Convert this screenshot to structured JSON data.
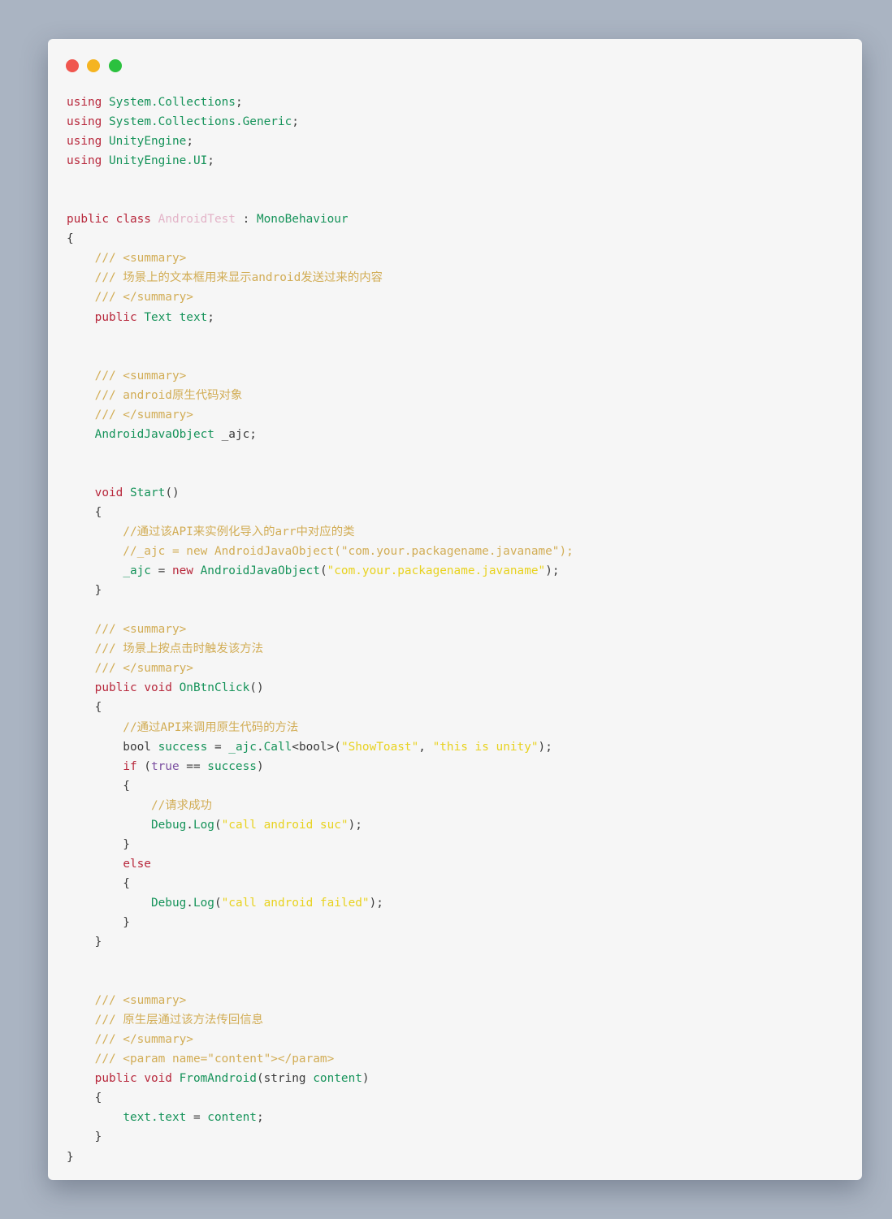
{
  "window": {
    "controls": [
      {
        "name": "close-button",
        "color": "#f0564f"
      },
      {
        "name": "minimize-button",
        "color": "#f5b421"
      },
      {
        "name": "maximize-button",
        "color": "#2bc13e"
      }
    ]
  },
  "colors": {
    "keyword": "#b8283c",
    "identifier": "#16935a",
    "comment": "#d2ad56",
    "string": "#e8d21f",
    "plain": "#3a3a3a",
    "class_name": "#e3b4c8",
    "boolean": "#7b4fa0",
    "background": "#aab4c2",
    "card": "#f6f6f6"
  },
  "code": {
    "lines": [
      [
        [
          "k",
          "using"
        ],
        [
          "p",
          " "
        ],
        [
          "t",
          "System.Collections"
        ],
        [
          "p",
          ";"
        ]
      ],
      [
        [
          "k",
          "using"
        ],
        [
          "p",
          " "
        ],
        [
          "t",
          "System.Collections.Generic"
        ],
        [
          "p",
          ";"
        ]
      ],
      [
        [
          "k",
          "using"
        ],
        [
          "p",
          " "
        ],
        [
          "t",
          "UnityEngine"
        ],
        [
          "p",
          ";"
        ]
      ],
      [
        [
          "k",
          "using"
        ],
        [
          "p",
          " "
        ],
        [
          "t",
          "UnityEngine.UI"
        ],
        [
          "p",
          ";"
        ]
      ],
      [],
      [],
      [
        [
          "k",
          "public"
        ],
        [
          "p",
          " "
        ],
        [
          "k",
          "class"
        ],
        [
          "p",
          " "
        ],
        [
          "n",
          "AndroidTest"
        ],
        [
          "p",
          " : "
        ],
        [
          "t",
          "MonoBehaviour"
        ]
      ],
      [
        [
          "p",
          "{"
        ]
      ],
      [
        [
          "c",
          "    /// <summary>"
        ]
      ],
      [
        [
          "c",
          "    /// 场景上的文本框用来显示android发送过来的内容"
        ]
      ],
      [
        [
          "c",
          "    /// </summary>"
        ]
      ],
      [
        [
          "p",
          "    "
        ],
        [
          "k",
          "public"
        ],
        [
          "p",
          " "
        ],
        [
          "t",
          "Text"
        ],
        [
          "p",
          " "
        ],
        [
          "t",
          "text"
        ],
        [
          "p",
          ";"
        ]
      ],
      [],
      [],
      [
        [
          "c",
          "    /// <summary>"
        ]
      ],
      [
        [
          "c",
          "    /// android原生代码对象"
        ]
      ],
      [
        [
          "c",
          "    /// </summary>"
        ]
      ],
      [
        [
          "p",
          "    "
        ],
        [
          "t",
          "AndroidJavaObject"
        ],
        [
          "p",
          " _ajc;"
        ]
      ],
      [],
      [],
      [
        [
          "p",
          "    "
        ],
        [
          "k",
          "void"
        ],
        [
          "p",
          " "
        ],
        [
          "t",
          "Start"
        ],
        [
          "p",
          "()"
        ]
      ],
      [
        [
          "p",
          "    {"
        ]
      ],
      [
        [
          "c",
          "        //通过该API来实例化导入的arr中对应的类"
        ]
      ],
      [
        [
          "c",
          "        //_ajc = new AndroidJavaObject(\"com.your.packagename.javaname\");"
        ]
      ],
      [
        [
          "p",
          "        "
        ],
        [
          "t",
          "_ajc"
        ],
        [
          "p",
          " = "
        ],
        [
          "k",
          "new"
        ],
        [
          "p",
          " "
        ],
        [
          "t",
          "AndroidJavaObject"
        ],
        [
          "p",
          "("
        ],
        [
          "s",
          "\"com.your.packagename.javaname\""
        ],
        [
          "p",
          ");"
        ]
      ],
      [
        [
          "p",
          "    }"
        ]
      ],
      [],
      [
        [
          "c",
          "    /// <summary>"
        ]
      ],
      [
        [
          "c",
          "    /// 场景上按点击时触发该方法"
        ]
      ],
      [
        [
          "c",
          "    /// </summary>"
        ]
      ],
      [
        [
          "p",
          "    "
        ],
        [
          "k",
          "public"
        ],
        [
          "p",
          " "
        ],
        [
          "k",
          "void"
        ],
        [
          "p",
          " "
        ],
        [
          "t",
          "OnBtnClick"
        ],
        [
          "p",
          "()"
        ]
      ],
      [
        [
          "p",
          "    {"
        ]
      ],
      [
        [
          "c",
          "        //通过API来调用原生代码的方法"
        ]
      ],
      [
        [
          "p",
          "        bool "
        ],
        [
          "t",
          "success"
        ],
        [
          "p",
          " = "
        ],
        [
          "t",
          "_ajc"
        ],
        [
          "p",
          "."
        ],
        [
          "t",
          "Call"
        ],
        [
          "p",
          "<bool>("
        ],
        [
          "s",
          "\"ShowToast\""
        ],
        [
          "p",
          ", "
        ],
        [
          "s",
          "\"this is unity\""
        ],
        [
          "p",
          ");"
        ]
      ],
      [
        [
          "p",
          "        "
        ],
        [
          "k",
          "if"
        ],
        [
          "p",
          " ("
        ],
        [
          "b",
          "true"
        ],
        [
          "p",
          " == "
        ],
        [
          "t",
          "success"
        ],
        [
          "p",
          ")"
        ]
      ],
      [
        [
          "p",
          "        {"
        ]
      ],
      [
        [
          "c",
          "            //请求成功"
        ]
      ],
      [
        [
          "p",
          "            "
        ],
        [
          "t",
          "Debug"
        ],
        [
          "p",
          "."
        ],
        [
          "t",
          "Log"
        ],
        [
          "p",
          "("
        ],
        [
          "s",
          "\"call android suc\""
        ],
        [
          "p",
          ");"
        ]
      ],
      [
        [
          "p",
          "        }"
        ]
      ],
      [
        [
          "p",
          "        "
        ],
        [
          "k",
          "else"
        ]
      ],
      [
        [
          "p",
          "        {"
        ]
      ],
      [
        [
          "p",
          "            "
        ],
        [
          "t",
          "Debug"
        ],
        [
          "p",
          "."
        ],
        [
          "t",
          "Log"
        ],
        [
          "p",
          "("
        ],
        [
          "s",
          "\"call android failed\""
        ],
        [
          "p",
          ");"
        ]
      ],
      [
        [
          "p",
          "        }"
        ]
      ],
      [
        [
          "p",
          "    }"
        ]
      ],
      [],
      [],
      [
        [
          "c",
          "    /// <summary>"
        ]
      ],
      [
        [
          "c",
          "    /// 原生层通过该方法传回信息"
        ]
      ],
      [
        [
          "c",
          "    /// </summary>"
        ]
      ],
      [
        [
          "c",
          "    /// <param name=\"content\"></param>"
        ]
      ],
      [
        [
          "p",
          "    "
        ],
        [
          "k",
          "public"
        ],
        [
          "p",
          " "
        ],
        [
          "k",
          "void"
        ],
        [
          "p",
          " "
        ],
        [
          "t",
          "FromAndroid"
        ],
        [
          "p",
          "(string "
        ],
        [
          "t",
          "content"
        ],
        [
          "p",
          ")"
        ]
      ],
      [
        [
          "p",
          "    {"
        ]
      ],
      [
        [
          "p",
          "        "
        ],
        [
          "t",
          "text.text"
        ],
        [
          "p",
          " = "
        ],
        [
          "t",
          "content"
        ],
        [
          "p",
          ";"
        ]
      ],
      [
        [
          "p",
          "    }"
        ]
      ],
      [
        [
          "p",
          "}"
        ]
      ]
    ]
  }
}
